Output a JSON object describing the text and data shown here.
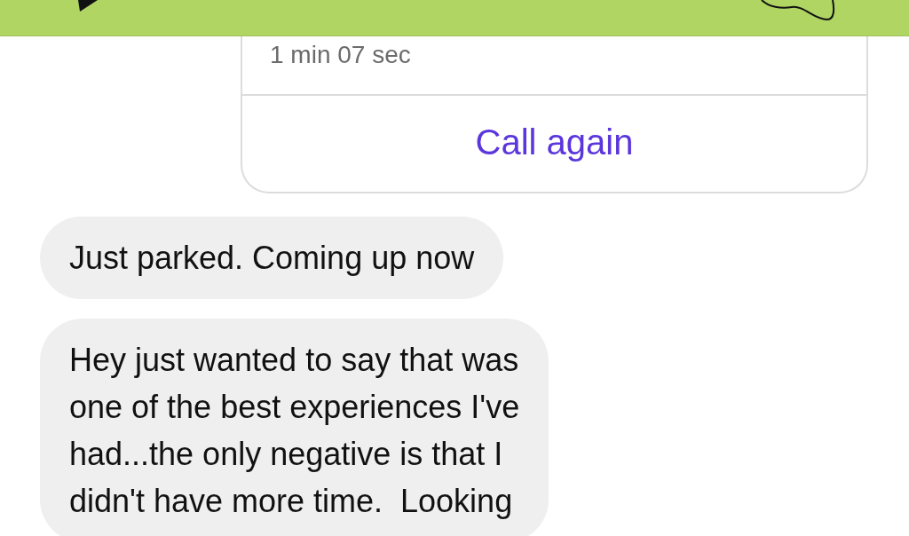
{
  "call_card": {
    "duration": "1 min 07 sec",
    "action": "Call again"
  },
  "messages": [
    {
      "text": "Just parked. Coming up now"
    },
    {
      "text": "Hey just wanted to say that was\none of the best experiences I've\nhad...the only negative is that I\ndidn't have more time.  Looking"
    }
  ]
}
